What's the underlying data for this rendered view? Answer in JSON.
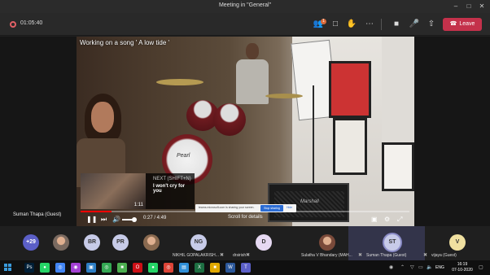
{
  "window": {
    "title": "Meeting in \"General\"",
    "controls": [
      "minimize-icon",
      "maximize-icon",
      "close-icon"
    ]
  },
  "toolbar": {
    "recording_icon": "record-icon",
    "timer": "01:05:40",
    "participants_badge": "1",
    "leave_label": "Leave",
    "leave_color": "#c4314b",
    "icons": [
      "participants-icon",
      "chat-icon",
      "raise-hand-icon",
      "more-icon",
      "camera-off-icon",
      "mic-off-icon",
      "share-tray-icon",
      "phone-icon"
    ]
  },
  "video": {
    "title": "Working on a song ' A low tide '",
    "brand_label": "Pearl",
    "amp_label": "Marshall",
    "next_up": {
      "label": "NEXT (SHIFT+N)",
      "title": "I won't cry for you",
      "thumb_duration": "1:11"
    },
    "player": {
      "time": "0:27 / 4:49",
      "progress_fraction": 0.093,
      "volume_fraction": 0.75,
      "accent": "#ff0000"
    },
    "share_banner": {
      "text": "teams.microsoft.com is sharing your screen.",
      "stop_label": "Stop sharing",
      "hide_label": "Hide"
    },
    "scroll_hint": "Scroll for details",
    "presenter": "Suman Thapa (Guest)"
  },
  "participants": [
    {
      "initials": "+29",
      "name": "",
      "color": "#5b5fc7"
    },
    {
      "initials": "",
      "name": "",
      "color": "#7a6a60",
      "photo": true
    },
    {
      "initials": "BR",
      "name": "",
      "color": "#c7cbe8"
    },
    {
      "initials": "PR",
      "name": "",
      "color": "#c7cbe8"
    },
    {
      "initials": "",
      "name": "",
      "color": "#8a6a50",
      "photo": true
    },
    {
      "initials": "NG",
      "name": "NIKHIL GOPALAKRISH...",
      "color": "#c7cbe8"
    },
    {
      "initials": "D",
      "name": "drsirish",
      "color": "#e6d9f2"
    },
    {
      "initials": "",
      "name": "Sulatha V Bhandary (MAH...",
      "color": "#7a4a3a",
      "photo": true
    },
    {
      "initials": "ST",
      "name": "Suman Thapa (Guest)",
      "color": "#c7cbe8"
    },
    {
      "initials": "V",
      "name": "vijaya (Guest)",
      "color": "#f0e0a0"
    }
  ],
  "taskbar": {
    "apps": [
      "photoshop-icon",
      "whatsapp-icon",
      "chrome-icon",
      "messenger-icon",
      "teams-icon",
      "chrome-2-icon",
      "camera-icon",
      "opera-icon",
      "whatsapp-2-icon",
      "chrome-3-icon",
      "files-icon",
      "excel-icon",
      "folder-icon",
      "word-icon",
      "teams-2-icon"
    ],
    "lang": "ENG",
    "time": "16:19",
    "date": "07-10-2020"
  }
}
